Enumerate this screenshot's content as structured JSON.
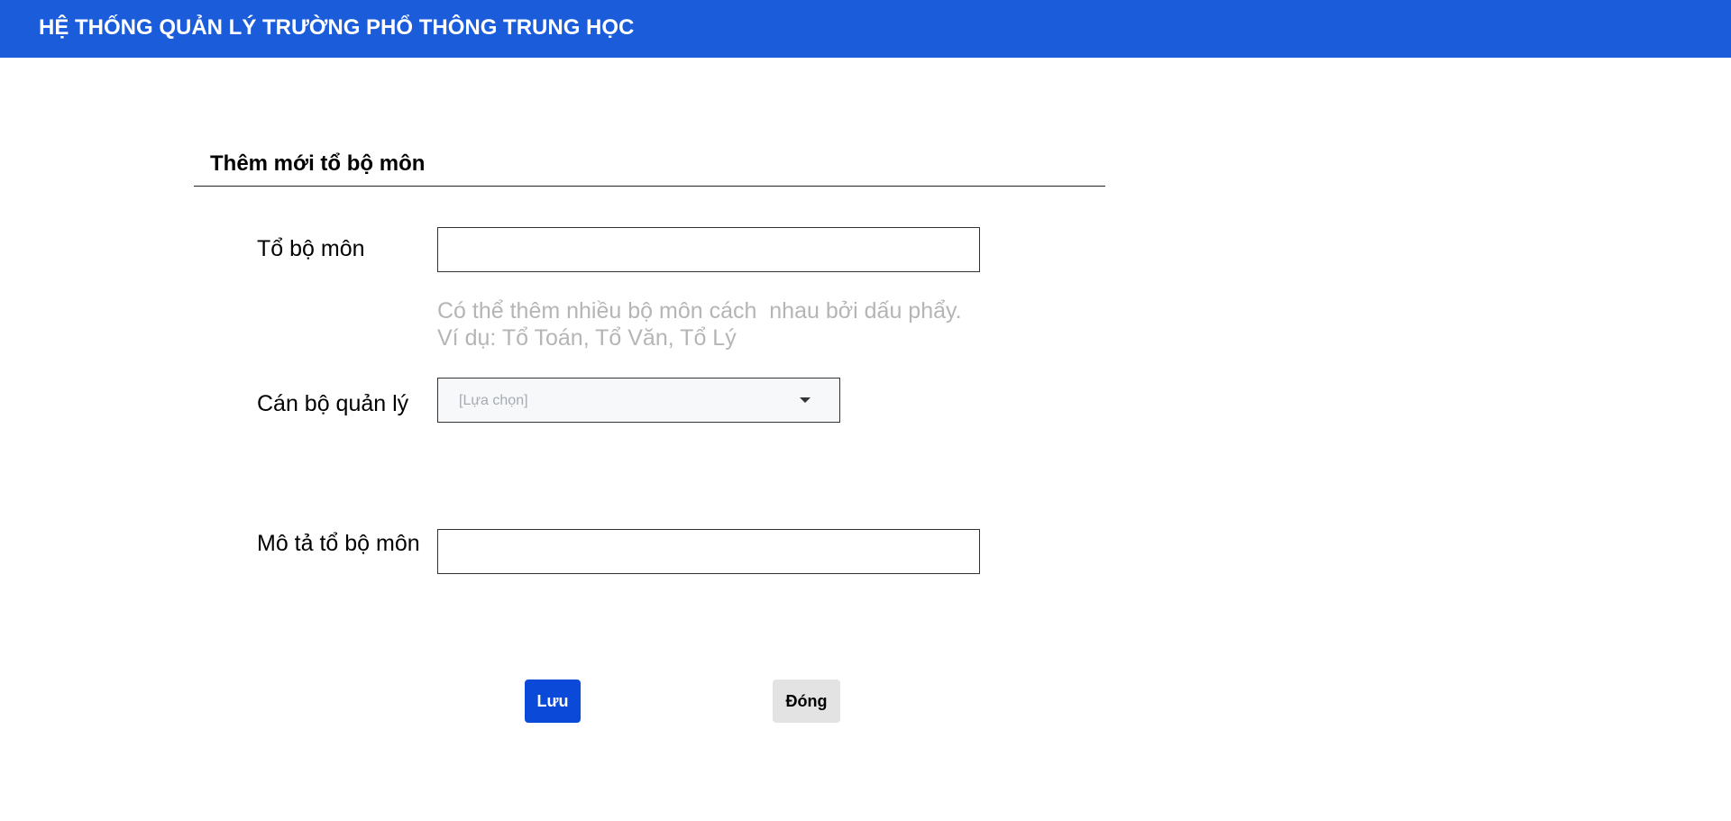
{
  "header": {
    "title": "HỆ THỐNG QUẢN LÝ TRƯỜNG PHỔ THÔNG TRUNG HỌC",
    "background_color": "#1b5cdb"
  },
  "form": {
    "title": "Thêm mới tổ bộ môn",
    "department": {
      "label": "Tổ bộ môn",
      "value": "",
      "hint_line1": "Có thể thêm nhiều bộ môn cách  nhau bởi dấu phẩy.",
      "hint_line2": "Ví dụ: Tổ Toán, Tổ Văn, Tổ Lý"
    },
    "manager": {
      "label": "Cán bộ quản lý",
      "selected": "[Lựa chọn]",
      "icon": "chevron-down-icon"
    },
    "description": {
      "label": "Mô tả tổ bộ môn",
      "value": ""
    }
  },
  "actions": {
    "save_label": "Lưu",
    "save_color": "#0b49d8",
    "close_label": "Đóng",
    "close_color": "#e3e3e3"
  }
}
